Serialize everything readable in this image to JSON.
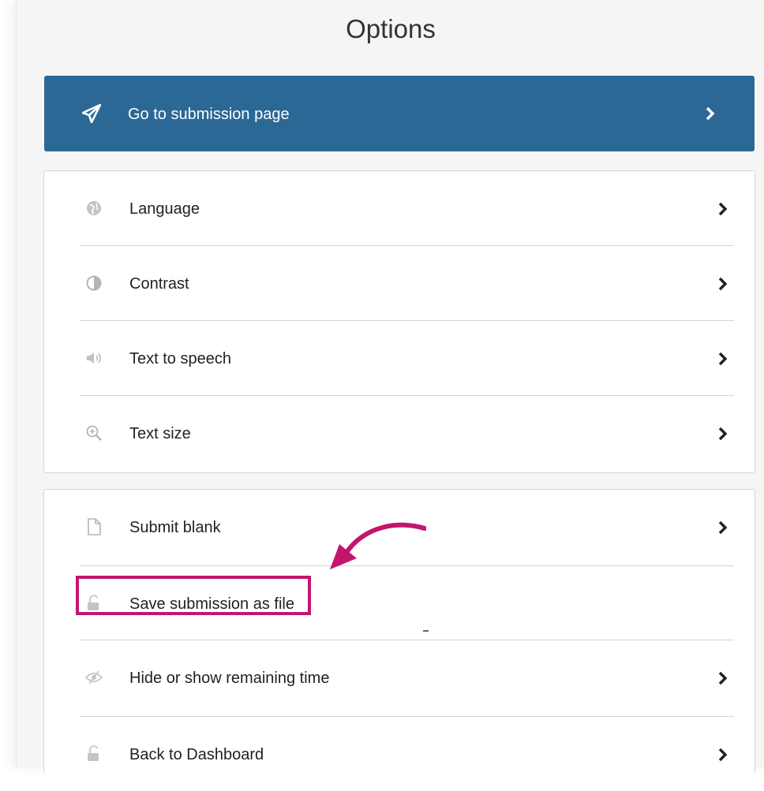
{
  "dialog": {
    "title": "Options"
  },
  "primary_action": {
    "label": "Go to submission page",
    "icon": "paper-plane-icon"
  },
  "settings_group": {
    "items": [
      {
        "label": "Language",
        "icon": "globe-icon",
        "has_chevron": true
      },
      {
        "label": "Contrast",
        "icon": "contrast-icon",
        "has_chevron": true
      },
      {
        "label": "Text to speech",
        "icon": "speaker-icon",
        "has_chevron": true
      },
      {
        "label": "Text size",
        "icon": "zoom-icon",
        "has_chevron": true
      }
    ]
  },
  "actions_group": {
    "items": [
      {
        "label": "Submit blank",
        "icon": "blank-page-icon",
        "has_chevron": true
      },
      {
        "label": "Save submission as file",
        "icon": "unlock-icon",
        "has_chevron": false
      },
      {
        "label": "Hide or show remaining time",
        "icon": "eye-slash-icon",
        "has_chevron": true
      },
      {
        "label": "Back to Dashboard",
        "icon": "unlock-icon",
        "has_chevron": true
      }
    ]
  },
  "colors": {
    "primary": "#2b6896",
    "highlight": "#c2166d",
    "panel_bg": "#f5f5f5",
    "icon_gray": "#b4b4b4"
  }
}
